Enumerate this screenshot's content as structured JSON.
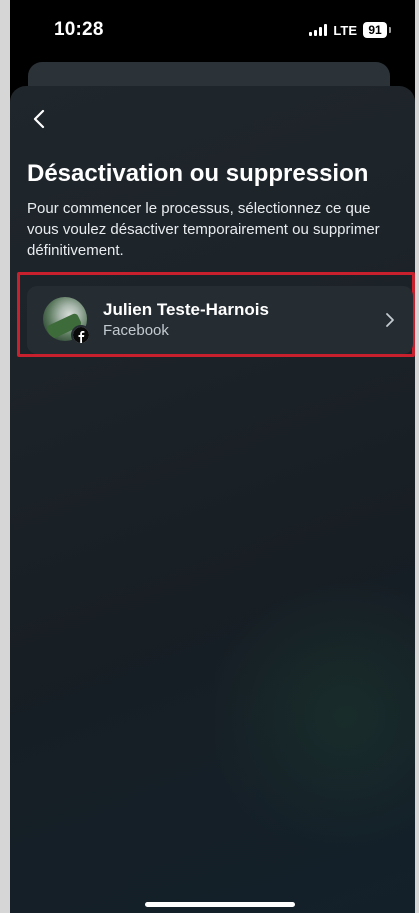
{
  "status_bar": {
    "time": "10:28",
    "network": "LTE",
    "battery": "91"
  },
  "header": {
    "back_icon": "chevron-left-icon",
    "title": "Désactivation ou suppression",
    "description": "Pour commencer le processus, sélectionnez ce que vous voulez désactiver temporairement ou supprimer définitivement."
  },
  "accounts": [
    {
      "name": "Julien Teste-Harnois",
      "platform": "Facebook",
      "badge_icon": "facebook-icon",
      "chevron_icon": "chevron-right-icon"
    }
  ],
  "colors": {
    "highlight": "#c8202c",
    "card": "#252d33",
    "background": "#1c2329"
  }
}
